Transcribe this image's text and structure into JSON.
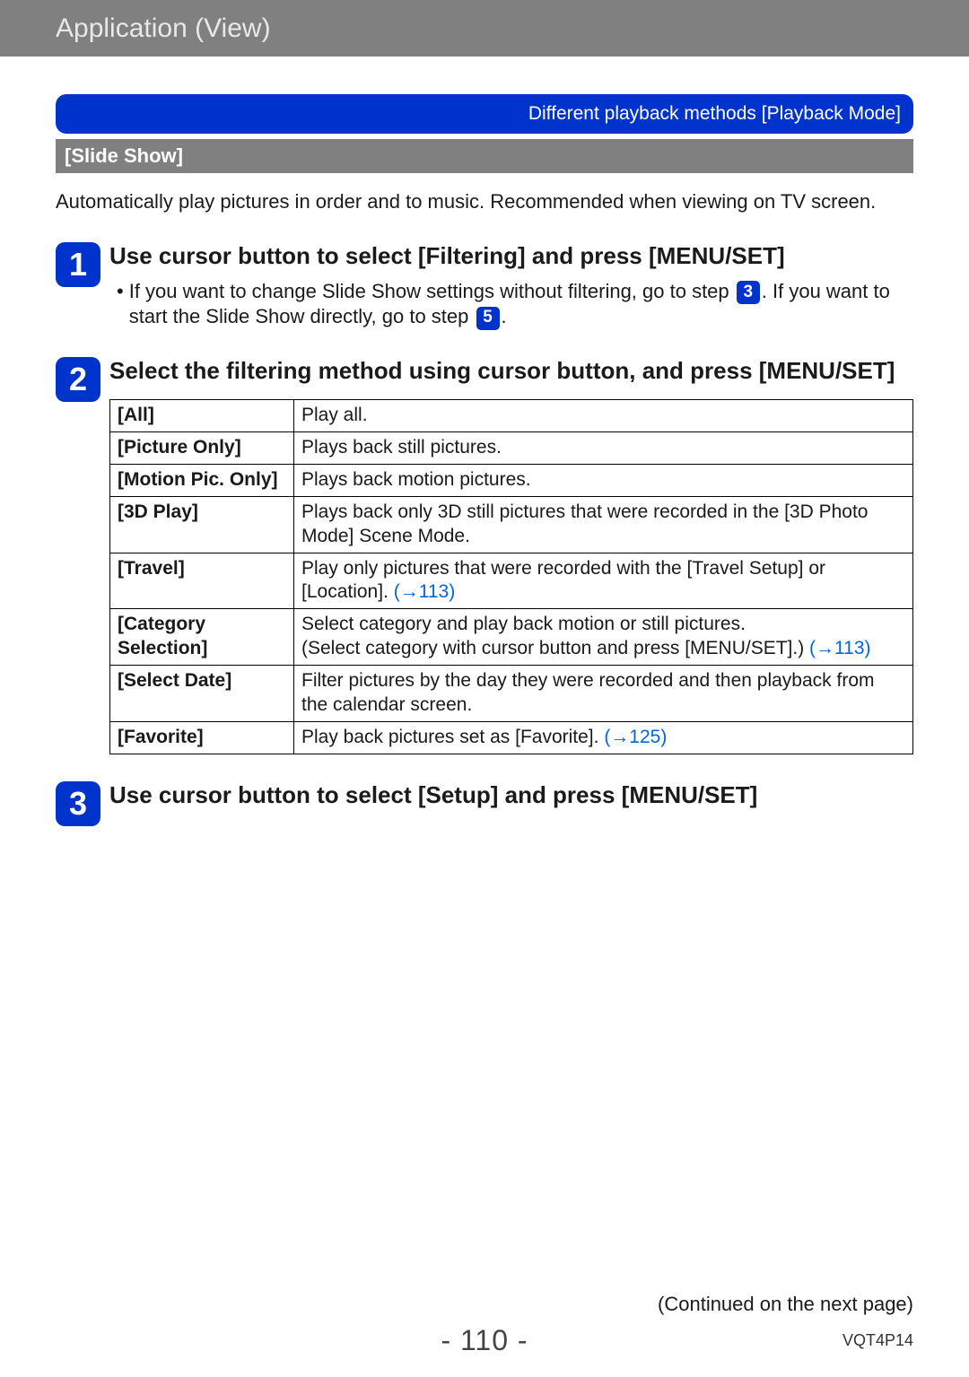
{
  "header": {
    "title": "Application (View)"
  },
  "banner": {
    "text": "Different playback methods  [Playback Mode]"
  },
  "section": {
    "title": "[Slide Show]"
  },
  "intro": "Automatically play pictures in order and to music. Recommended when viewing on TV screen.",
  "step1": {
    "num": "1",
    "title": "Use cursor button to select [Filtering] and press [MENU/SET]",
    "bullet_a": "If you want to change Slide Show settings without filtering, go to step ",
    "bullet_ref1": "3",
    "bullet_b": ". If you want to start the Slide Show directly, go to step ",
    "bullet_ref2": "5",
    "bullet_c": "."
  },
  "step2": {
    "num": "2",
    "title": "Select the filtering method using cursor button, and press [MENU/SET]",
    "rows": [
      {
        "label": "[All]",
        "desc": "Play all."
      },
      {
        "label": "[Picture Only]",
        "desc": "Plays back still pictures."
      },
      {
        "label": "[Motion Pic. Only]",
        "desc": "Plays back motion pictures."
      },
      {
        "label": "[3D Play]",
        "desc": "Plays back only 3D still pictures that were recorded in the [3D Photo Mode] Scene Mode."
      },
      {
        "label": "[Travel]",
        "desc": "Play only pictures that were recorded with the [Travel Setup] or [Location]. ",
        "link": "(→113)"
      },
      {
        "label": "[Category Selection]",
        "desc": "Select category and play back motion or still pictures.\n(Select category with cursor button and press [MENU/SET].) ",
        "link": "(→113)"
      },
      {
        "label": "[Select Date]",
        "desc": "Filter pictures by the day they were recorded and then playback from the calendar screen."
      },
      {
        "label": "[Favorite]",
        "desc": "Play back pictures set as [Favorite]. ",
        "link": "(→125)"
      }
    ]
  },
  "step3": {
    "num": "3",
    "title": "Use cursor button to select [Setup] and press [MENU/SET]"
  },
  "footer": {
    "continued": "(Continued on the next page)",
    "page": "- 110 -",
    "code": "VQT4P14"
  }
}
